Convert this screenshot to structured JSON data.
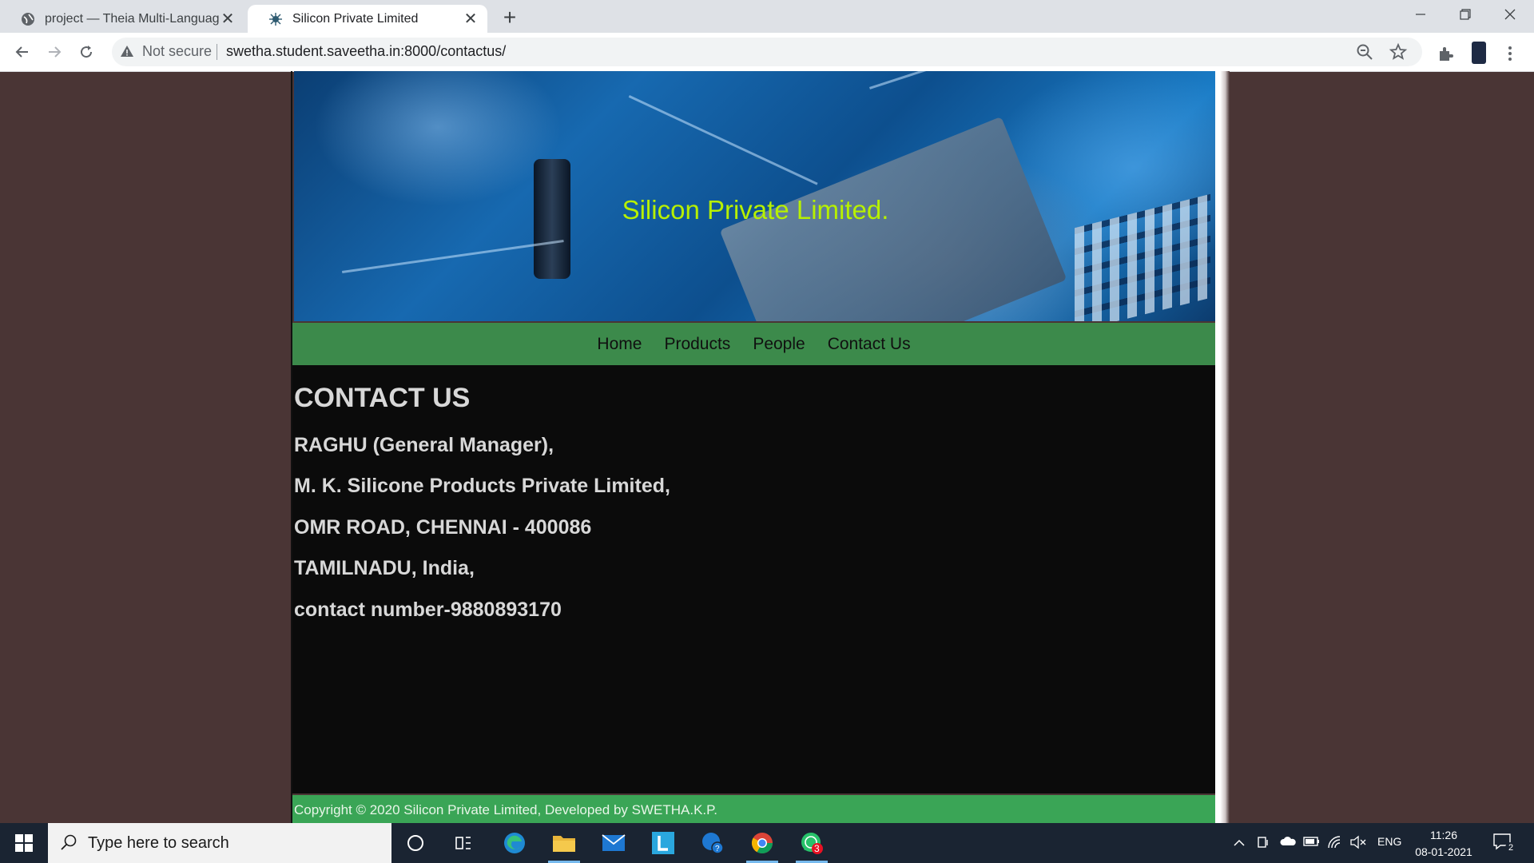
{
  "browser": {
    "tabs": [
      {
        "title": "project — Theia Multi-Language",
        "active": false,
        "favicon": "globe-icon"
      },
      {
        "title": "Silicon Private Limited",
        "active": true,
        "favicon": "bug-icon"
      }
    ],
    "address": {
      "security_label": "Not secure",
      "url": "swetha.student.saveetha.in:8000/contactus/"
    }
  },
  "site": {
    "banner_title": "Silicon Private Limited.",
    "nav": [
      "Home",
      "Products",
      "People",
      "Contact Us"
    ],
    "heading": "CONTACT US",
    "contact_lines": [
      "RAGHU (General Manager),",
      "M. K. Silicone Products Private Limited,",
      "OMR ROAD, CHENNAI - 400086",
      "TAMILNADU, India,",
      "contact number-9880893170"
    ],
    "footer": "Copyright © 2020 Silicon Private Limited, Developed by SWETHA.K.P.",
    "colors": {
      "banner_title": "#b7f000",
      "nav_bg": "#3c8a4b",
      "content_bg": "#0b0b0b",
      "footer_bg": "#3aa556",
      "page_bg": "#4a3535"
    }
  },
  "taskbar": {
    "search_placeholder": "Type here to search",
    "whatsapp_badge": "3",
    "tray_language": "ENG",
    "time": "11:26",
    "date": "08-01-2021",
    "notification_count": "2"
  }
}
